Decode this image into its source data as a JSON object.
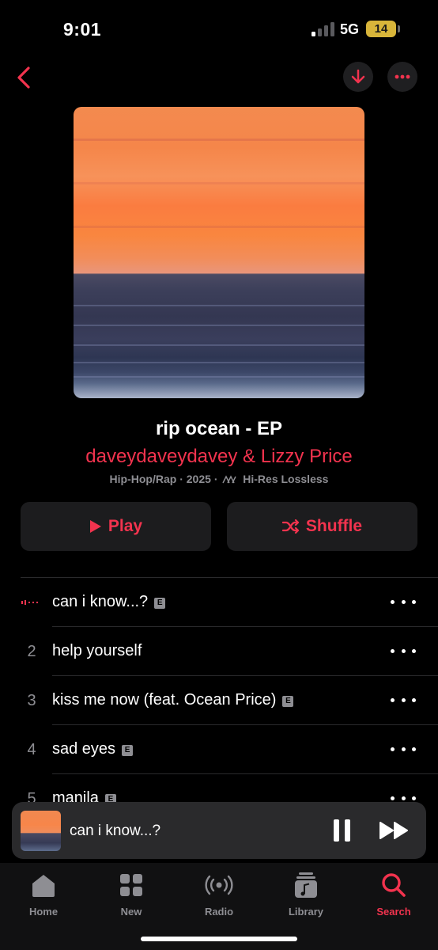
{
  "status": {
    "time": "9:01",
    "network": "5G",
    "battery": "14"
  },
  "album": {
    "title": "rip ocean - EP",
    "artist": "daveydaveydavey & Lizzy Price",
    "genre": "Hip-Hop/Rap",
    "year": "2025",
    "quality": "Hi-Res Lossless"
  },
  "actions": {
    "play": "Play",
    "shuffle": "Shuffle"
  },
  "tracks": [
    {
      "number": "",
      "title": "can i know...?",
      "explicit": "E",
      "playing": true
    },
    {
      "number": "2",
      "title": "help yourself",
      "explicit": ""
    },
    {
      "number": "3",
      "title": "kiss me now (feat. Ocean Price)",
      "explicit": "E"
    },
    {
      "number": "4",
      "title": "sad eyes",
      "explicit": "E"
    },
    {
      "number": "5",
      "title": "manila",
      "explicit": "E"
    }
  ],
  "now_playing": {
    "title": "can i know...?"
  },
  "tabs": [
    {
      "label": "Home",
      "icon": "home-icon"
    },
    {
      "label": "New",
      "icon": "grid-icon"
    },
    {
      "label": "Radio",
      "icon": "radio-icon"
    },
    {
      "label": "Library",
      "icon": "library-icon"
    },
    {
      "label": "Search",
      "icon": "search-icon",
      "active": true
    }
  ],
  "colors": {
    "accent": "#f2334e",
    "background": "#000000",
    "surface": "#1c1c1e",
    "secondary_text": "#8e8e93"
  }
}
